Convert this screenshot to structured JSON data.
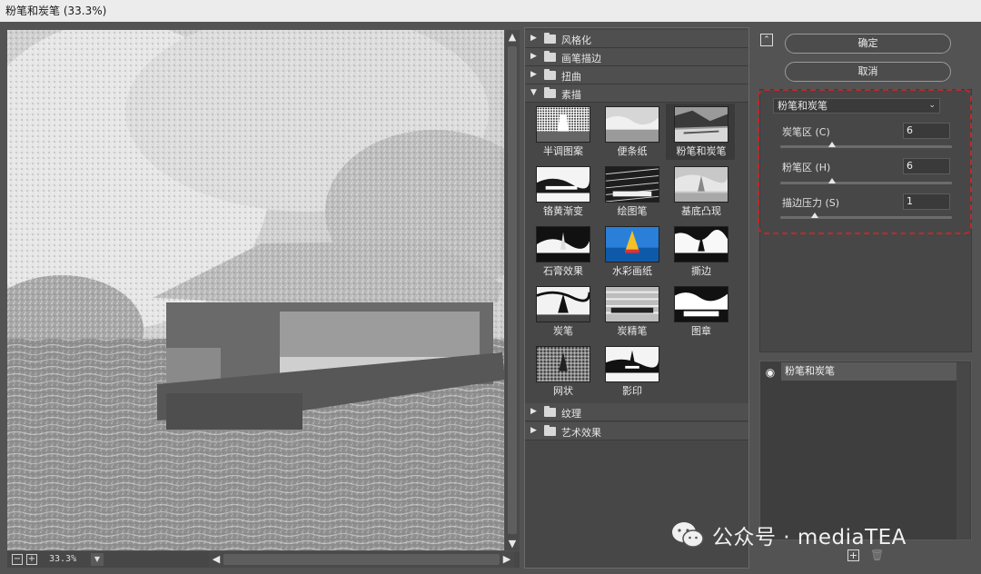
{
  "window": {
    "title": "粉笔和炭笔 (33.3%)"
  },
  "preview": {
    "zoom": "33.3%"
  },
  "gallery": {
    "folders_top": [
      {
        "label": "风格化",
        "expanded": false
      },
      {
        "label": "画笔描边",
        "expanded": false
      },
      {
        "label": "扭曲",
        "expanded": false
      },
      {
        "label": "素描",
        "expanded": true
      }
    ],
    "sketch_filters": [
      {
        "label": "半调图案",
        "icon": "halftone-thumb"
      },
      {
        "label": "便条纸",
        "icon": "notepaper-thumb"
      },
      {
        "label": "粉笔和炭笔",
        "icon": "chalk-charcoal-thumb",
        "selected": true
      },
      {
        "label": "铬黄渐变",
        "icon": "chrome-thumb"
      },
      {
        "label": "绘图笔",
        "icon": "graphic-pen-thumb"
      },
      {
        "label": "基底凸现",
        "icon": "bas-relief-thumb"
      },
      {
        "label": "石膏效果",
        "icon": "plaster-thumb"
      },
      {
        "label": "水彩画纸",
        "icon": "water-paper-thumb"
      },
      {
        "label": "撕边",
        "icon": "torn-edges-thumb"
      },
      {
        "label": "炭笔",
        "icon": "charcoal-thumb"
      },
      {
        "label": "炭精笔",
        "icon": "conte-crayon-thumb"
      },
      {
        "label": "图章",
        "icon": "stamp-thumb"
      },
      {
        "label": "网状",
        "icon": "reticulation-thumb"
      },
      {
        "label": "影印",
        "icon": "photocopy-thumb"
      }
    ],
    "folders_bottom": [
      {
        "label": "纹理",
        "expanded": false
      },
      {
        "label": "艺术效果",
        "expanded": false
      }
    ]
  },
  "actions": {
    "ok": "确定",
    "cancel": "取消"
  },
  "settings": {
    "selected_filter": "粉笔和炭笔",
    "params": [
      {
        "label": "炭笔区 (C)",
        "value": "6",
        "fraction": 0.3
      },
      {
        "label": "粉笔区 (H)",
        "value": "6",
        "fraction": 0.3
      },
      {
        "label": "描边压力 (S)",
        "value": "1",
        "fraction": 0.2
      }
    ],
    "highlight_color": "#c0282b"
  },
  "layers": {
    "items": [
      "粉笔和炭笔"
    ]
  },
  "watermark": {
    "text": "公众号 · mediaTEA"
  }
}
